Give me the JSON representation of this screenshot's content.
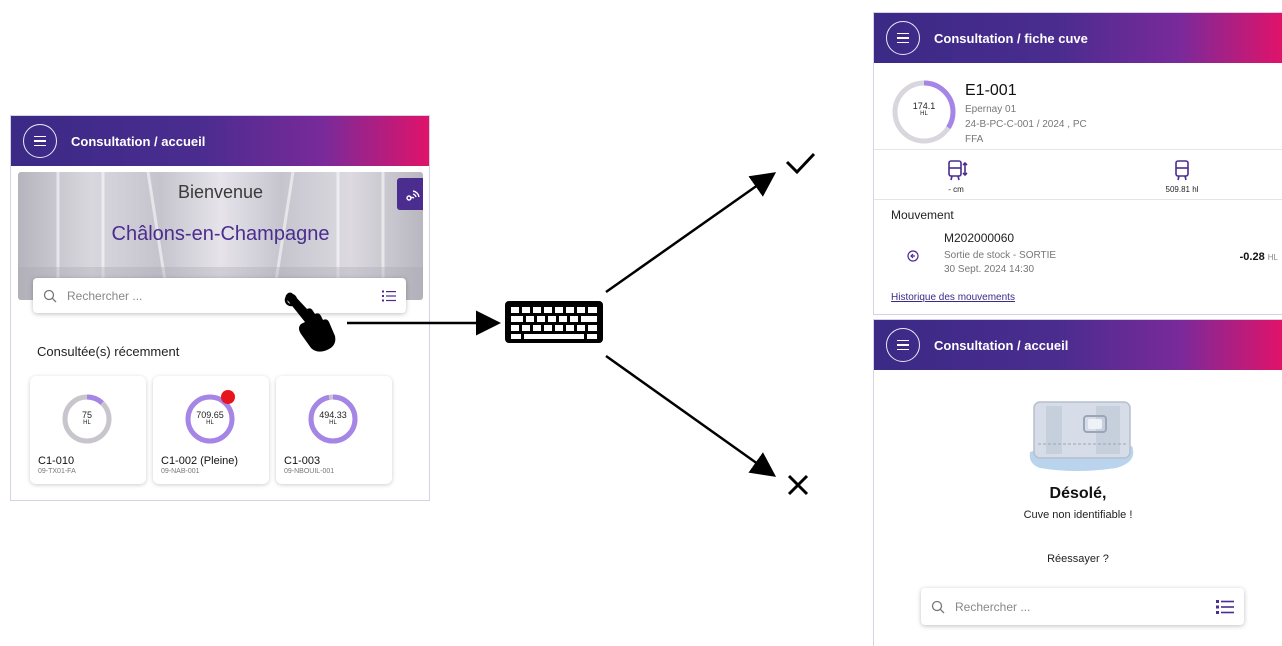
{
  "home": {
    "title": "Consultation / accueil",
    "welcome": "Bienvenue",
    "city": "Châlons-en-Champagne",
    "search_placeholder": "Rechercher ...",
    "recent_label": "Consultée(s) récemment",
    "cards": [
      {
        "value": "75",
        "unit": "HL",
        "code": "C1-010",
        "sub": "09-TX01-FA",
        "fill": 0.12,
        "color": "#c8c6cc"
      },
      {
        "value": "709.65",
        "unit": "HL",
        "code": "C1-002 (Pleine)",
        "sub": "09-NAB-001",
        "fill": 1.0,
        "color": "#a585e6"
      },
      {
        "value": "494.33",
        "unit": "HL",
        "code": "C1-003",
        "sub": "09-NBOUIL-001",
        "fill": 0.97,
        "color": "#a585e6"
      }
    ]
  },
  "tank": {
    "title": "Consultation / fiche cuve",
    "gauge_value": "174.1",
    "gauge_unit": "HL",
    "gauge_fill": 0.34,
    "code": "E1-001",
    "line1": "Epernay 01",
    "line2": "24-B-PC-C-001 / 2024 , PC",
    "line3": "FFA",
    "metric_left": "- cm",
    "metric_right": "509.81 hl",
    "movement_label": "Mouvement",
    "movement_id": "M202000060",
    "movement_type": "Sortie de stock - SORTIE",
    "movement_date": "30 Sept. 2024 14:30",
    "movement_amount": "-0.28",
    "movement_unit": "HL",
    "history_link": "Historique des mouvements"
  },
  "error": {
    "title": "Consultation / accueil",
    "sorry": "Désolé,",
    "message": "Cuve non identifiable !",
    "retry": "Réessayer ?",
    "search_placeholder": "Rechercher ..."
  },
  "colors": {
    "accent": "#4b2c8f",
    "brand_pink": "#e0136a",
    "gauge": "#a585e6",
    "alert_dot": "#e8141c"
  }
}
